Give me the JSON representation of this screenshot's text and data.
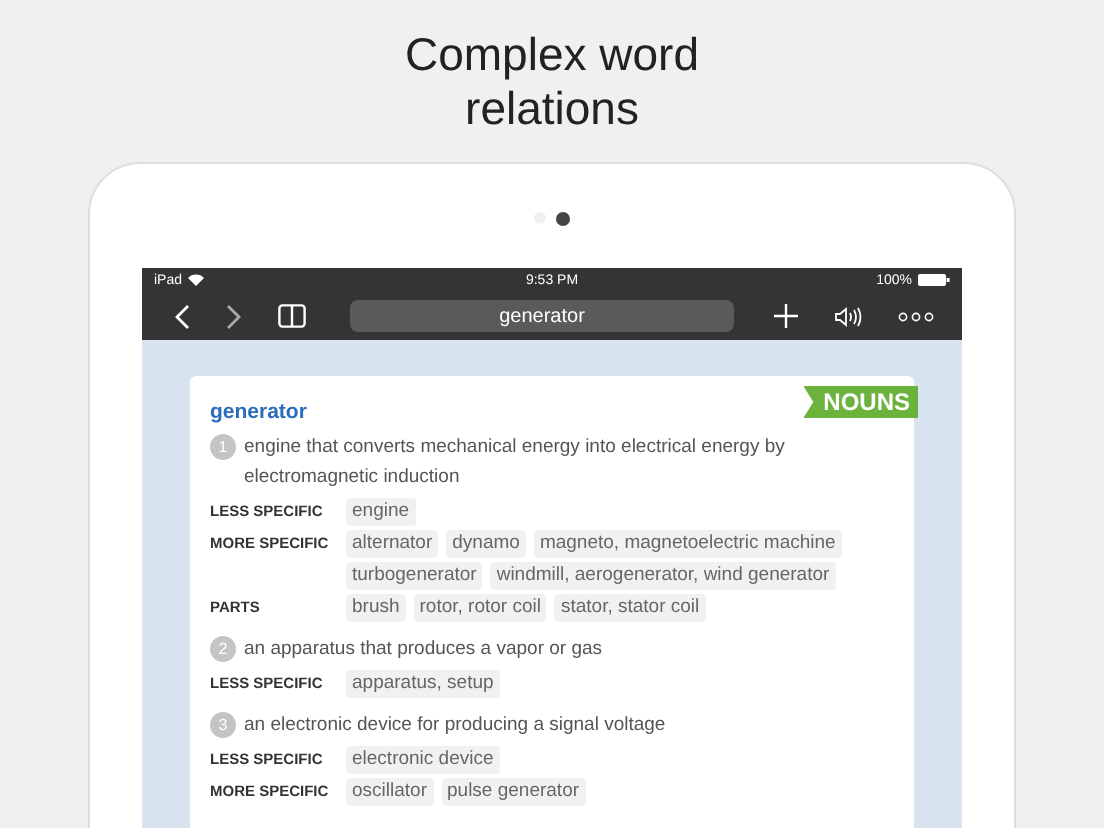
{
  "headline_lines": [
    "Complex word",
    "relations"
  ],
  "pager": [
    {
      "selected": false
    },
    {
      "selected": true
    }
  ],
  "status_bar": {
    "device": "iPad",
    "time": "9:53 PM",
    "battery": "100%"
  },
  "toolbar": {
    "search_value": "generator"
  },
  "entry": {
    "word": "generator",
    "badge": "NOUNS",
    "senses": [
      {
        "number": "1",
        "definition": "engine that converts mechanical energy into electrical energy by electromagnetic induction",
        "relations": [
          {
            "label": "LESS SPECIFIC",
            "terms": [
              "engine"
            ]
          },
          {
            "label": "MORE SPECIFIC",
            "terms": [
              "alternator",
              "dynamo",
              "magneto, magnetoelectric machine",
              "turbogenerator",
              "windmill, aerogenerator, wind generator"
            ]
          },
          {
            "label": "PARTS",
            "terms": [
              "brush",
              "rotor, rotor coil",
              "stator, stator coil"
            ]
          }
        ]
      },
      {
        "number": "2",
        "definition": "an apparatus that produces a vapor or gas",
        "relations": [
          {
            "label": "LESS SPECIFIC",
            "terms": [
              "apparatus, setup"
            ]
          }
        ]
      },
      {
        "number": "3",
        "definition": "an electronic device for producing a signal voltage",
        "relations": [
          {
            "label": "LESS SPECIFIC",
            "terms": [
              "electronic device"
            ]
          },
          {
            "label": "MORE SPECIFIC",
            "terms": [
              "oscillator",
              "pulse generator"
            ]
          }
        ]
      }
    ]
  }
}
